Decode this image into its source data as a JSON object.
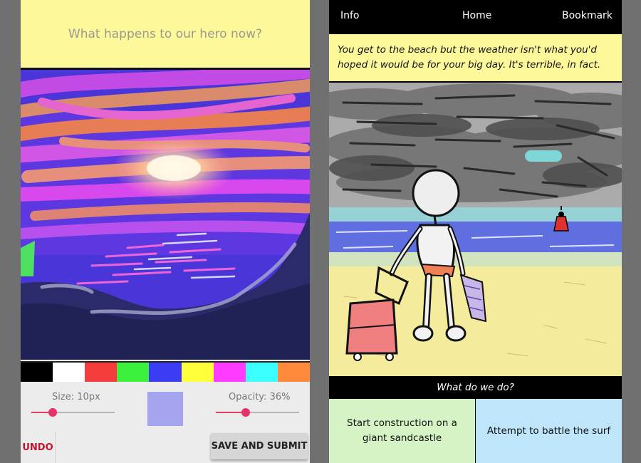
{
  "drawing_screen": {
    "prompt": "What happens to our hero now?",
    "palette": [
      "#000000",
      "#ffffff",
      "#f43c3c",
      "#3cf03c",
      "#3c3cf4",
      "#ffff3c",
      "#ff3cff",
      "#3cffff",
      "#ff8a3c"
    ],
    "size_label": "Size: 10px",
    "size_value": 10,
    "opacity_label": "Opacity: 36%",
    "opacity_value": 36,
    "preview_color": "#a5a5ef",
    "undo_label": "UNDO",
    "submit_label": "SAVE AND SUBMIT"
  },
  "story_screen": {
    "nav": {
      "info": "Info",
      "home": "Home",
      "bookmark": "Bookmark"
    },
    "story_text": "You get to the beach but the weather isn't what you'd hoped it would be for your big day. It's terrible, in fact.",
    "question": "What do we do?",
    "choices": [
      {
        "label": "Start construction on a giant sandcastle"
      },
      {
        "label": "Attempt to battle the surf"
      }
    ]
  },
  "colors": {
    "prompt_bg": "#fdf89a",
    "accent_pink": "#e7316a",
    "undo_red": "#c4122c",
    "choice_green": "#d6f3c6",
    "choice_blue": "#bfe5fa"
  }
}
